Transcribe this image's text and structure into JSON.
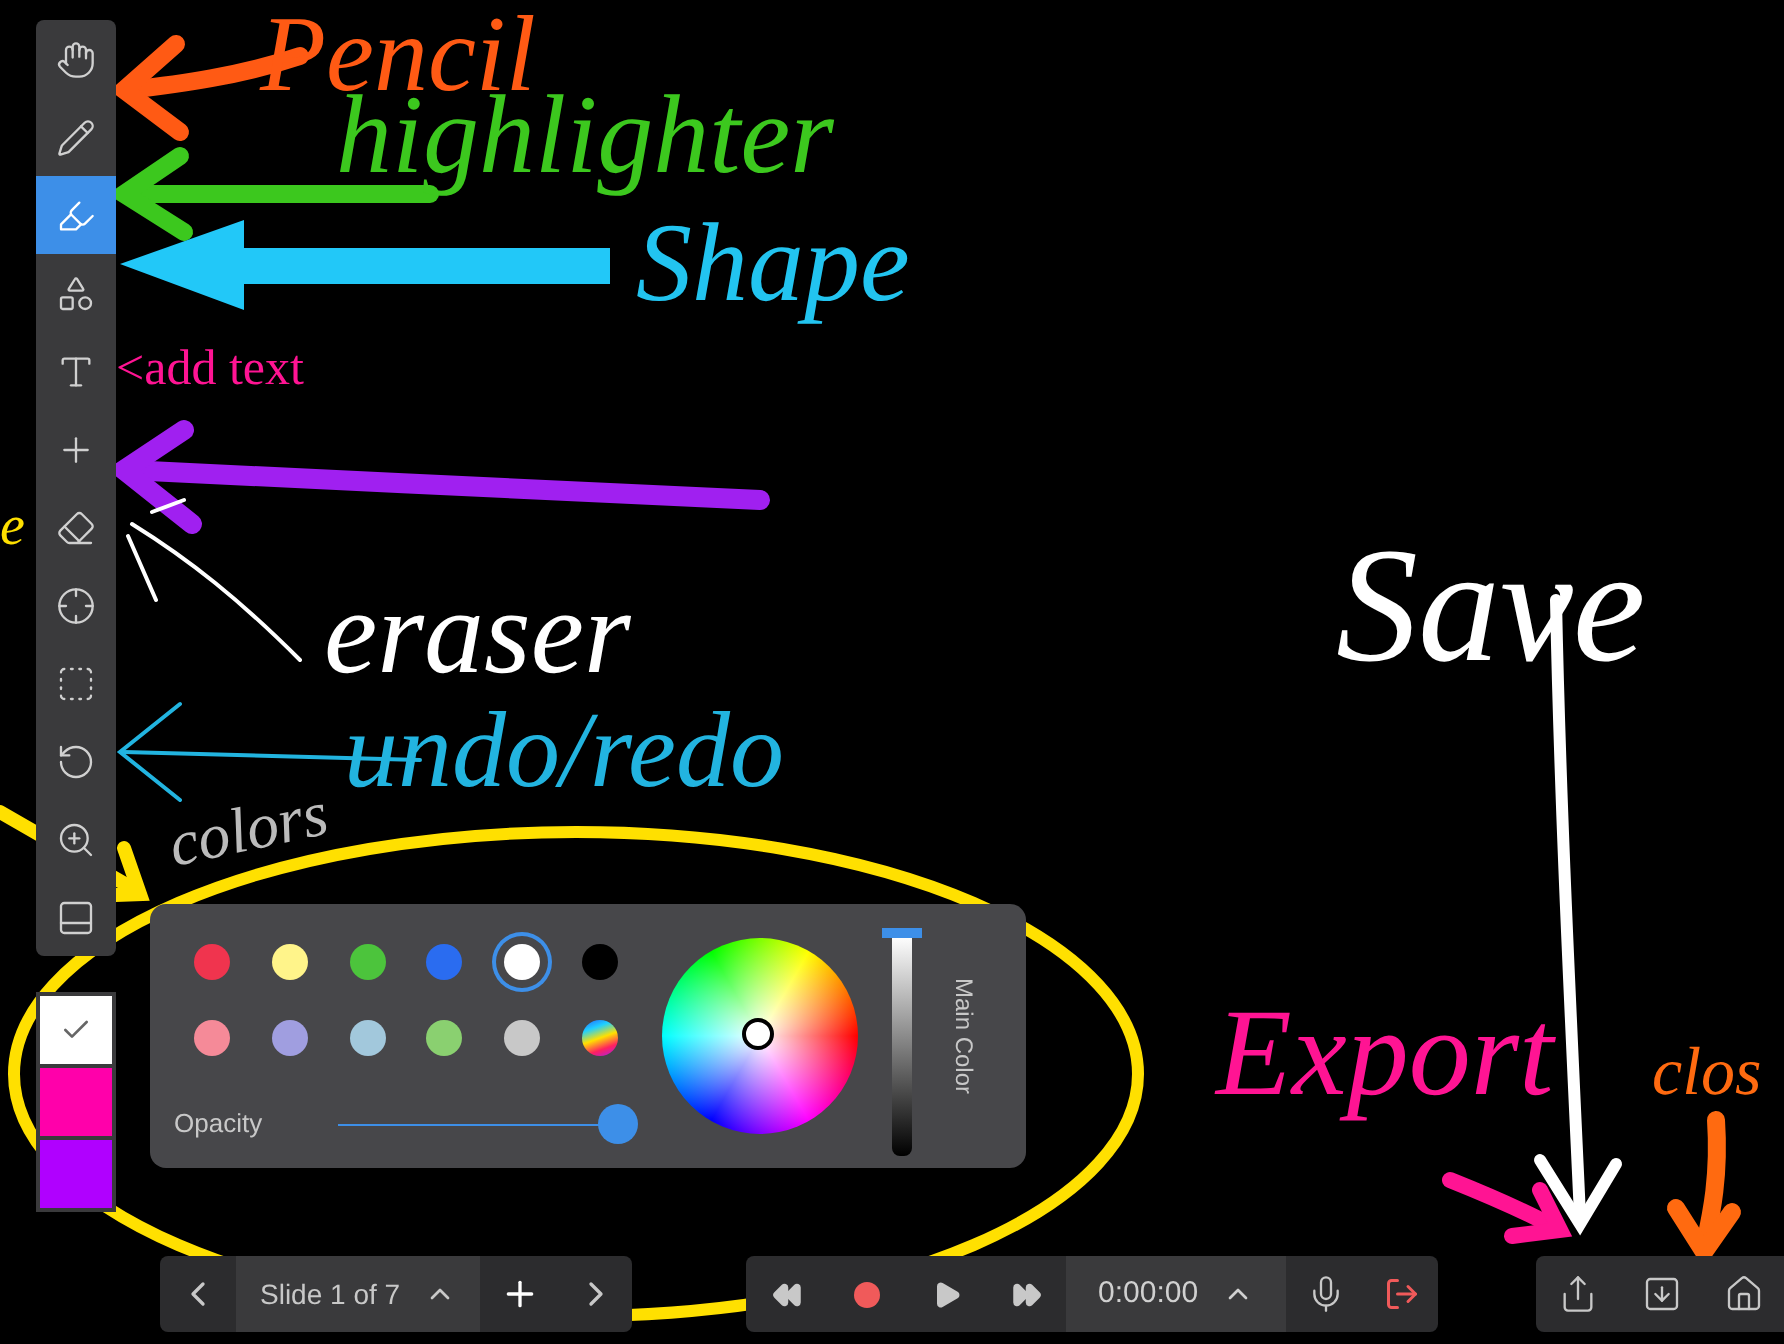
{
  "annotations": [
    {
      "text": "Pencil",
      "color": "#ff5a14"
    },
    {
      "text": "highlighter",
      "color": "#3cc81e"
    },
    {
      "text": "Shape",
      "color": "#22c4f0"
    },
    {
      "text": "<add text",
      "color": "#ff1493"
    },
    {
      "text": "eraser",
      "color": "#ffffff"
    },
    {
      "text": "undo/redo",
      "color": "#22b4e0"
    },
    {
      "text": "colors",
      "color": "#bbbbbb"
    },
    {
      "text": "Save",
      "color": "#ffffff"
    },
    {
      "text": "Export",
      "color": "#ff1493"
    },
    {
      "text": "clos",
      "color": "#ff6a10"
    },
    {
      "text": "e",
      "color": "#ffe000"
    }
  ],
  "tools": [
    {
      "selected": false
    },
    {
      "selected": false
    },
    {
      "selected": true
    },
    {
      "selected": false
    },
    {
      "selected": false
    },
    {
      "selected": false
    },
    {
      "selected": false
    },
    {
      "selected": false
    },
    {
      "selected": false
    },
    {
      "selected": false
    },
    {
      "selected": false
    },
    {
      "selected": false
    }
  ],
  "wells": [
    {
      "color": "#ffffff",
      "checked": true
    },
    {
      "color": "#ff00aa",
      "checked": false
    },
    {
      "color": "#b000ff",
      "checked": false
    }
  ],
  "palette": {
    "swatches": [
      {
        "kind": "solid",
        "color": "#f0344e",
        "selected": false
      },
      {
        "kind": "solid",
        "color": "#fff48a",
        "selected": false
      },
      {
        "kind": "solid",
        "color": "#4cc43c",
        "selected": false
      },
      {
        "kind": "solid",
        "color": "#2a6cf0",
        "selected": false
      },
      {
        "kind": "solid",
        "color": "#ffffff",
        "selected": true
      },
      {
        "kind": "solid",
        "color": "#000000",
        "selected": false
      },
      {
        "kind": "solid",
        "color": "#f58a98",
        "selected": false
      },
      {
        "kind": "solid",
        "color": "#a09ee0",
        "selected": false
      },
      {
        "kind": "solid",
        "color": "#a2c8dc",
        "selected": false
      },
      {
        "kind": "solid",
        "color": "#8ad070",
        "selected": false
      },
      {
        "kind": "solid",
        "color": "#c8c8c8",
        "selected": false
      },
      {
        "kind": "rainbow",
        "selected": false
      }
    ],
    "opacity_label": "Opacity",
    "opacity": {
      "level": 1
    },
    "brightness": {
      "level": 1
    },
    "main_color_label": "Main Color"
  },
  "slide_bar": {
    "label": "Slide 1 of 7"
  },
  "player": {
    "time": "0:00:00"
  }
}
